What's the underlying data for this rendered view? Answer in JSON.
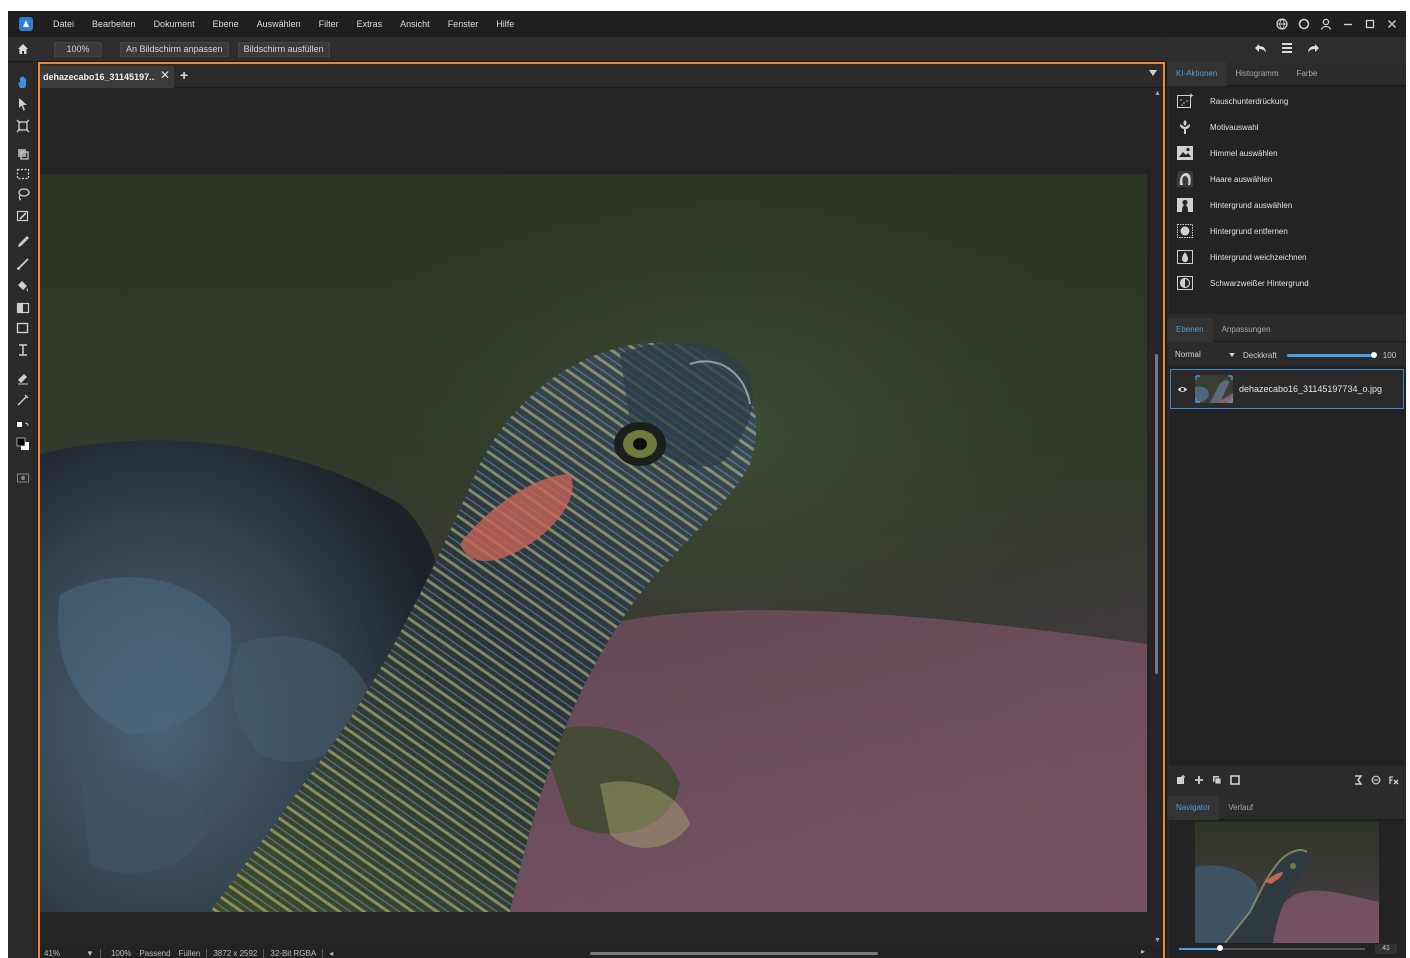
{
  "menubar": {
    "items": [
      "Datei",
      "Bearbeiten",
      "Dokument",
      "Ebene",
      "Auswählen",
      "Filter",
      "Extras",
      "Ansicht",
      "Fenster",
      "Hilfe"
    ]
  },
  "toolbar": {
    "zoom_value": "100%",
    "fit_label": "An Bildschirm anpassen",
    "fill_label": "Bildschirm ausfüllen"
  },
  "document": {
    "tab_label": "dehazecabo16_31145197...",
    "tab_close": "✕",
    "tab_add": "+"
  },
  "status": {
    "zoom": "41%",
    "zoom_100": "100%",
    "fit": "Passend",
    "fill": "Füllen",
    "dimensions": "3872 x 2592",
    "mode": "32-Bit RGBA"
  },
  "panel_top": {
    "tabs": [
      "KI-Aktionen",
      "Histogramm",
      "Farbe"
    ],
    "ki_actions": [
      "Rauschunterdrückung",
      "Motivauswahl",
      "Himmel auswählen",
      "Haare auswählen",
      "Hintergrund auswählen",
      "Hintergrund entfernen",
      "Hintergrund weichzeichnen",
      "Schwarzweißer Hintergrund"
    ]
  },
  "panel_layers": {
    "tabs": [
      "Ebenen",
      "Anpassungen"
    ],
    "blend_mode": "Normal",
    "opacity_label": "Deckkraft",
    "opacity_value": "100",
    "opacity_fraction": 1.0,
    "layer_name": "dehazecabo16_31145197734_o.jpg"
  },
  "panel_nav": {
    "tabs": [
      "Navigator",
      "Verlauf"
    ],
    "zoom_value": "41"
  },
  "colors": {
    "accent": "#4a9fe0",
    "focus_border": "#f08a24"
  }
}
